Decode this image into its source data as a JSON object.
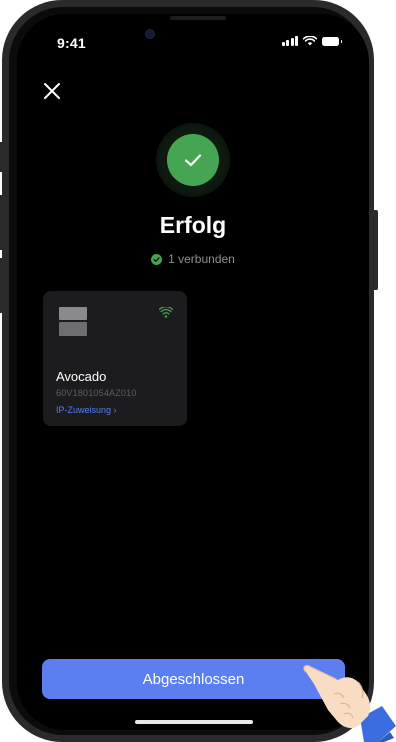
{
  "status_bar": {
    "time": "9:41"
  },
  "header": {
    "close_icon": "close-icon"
  },
  "result": {
    "icon": "checkmark-icon",
    "title": "Erfolg",
    "subtitle": "1 verbunden",
    "accent_color": "#46a552"
  },
  "device": {
    "name": "Avocado",
    "serial": "60V1801054AZ010",
    "link": "IP-Zuweisung ›",
    "status_icon": "wifi-icon"
  },
  "footer": {
    "done_label": "Abgeschlossen",
    "button_color": "#5b7ff0"
  }
}
